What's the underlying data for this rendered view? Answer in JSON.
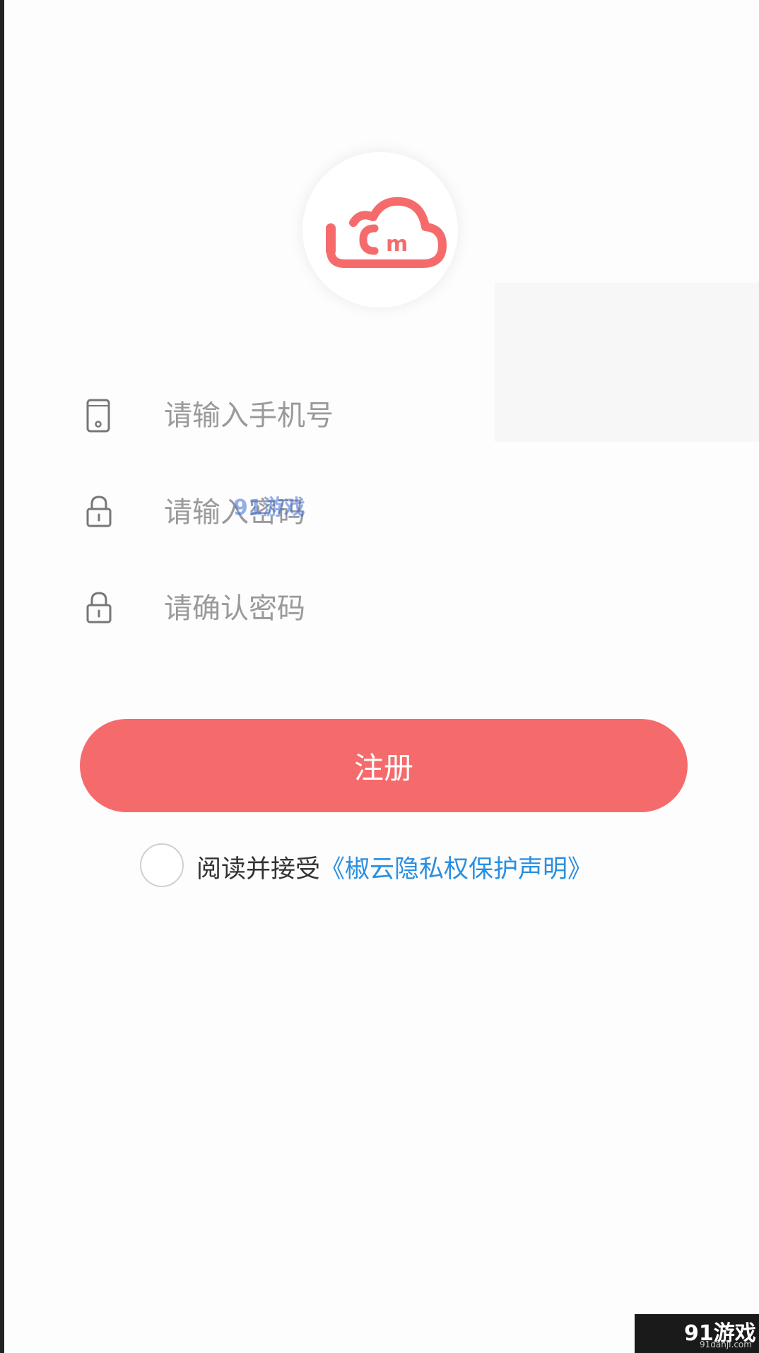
{
  "form": {
    "phone_placeholder": "请输入手机号",
    "password_placeholder": "请输入密码",
    "confirm_placeholder": "请确认密码"
  },
  "actions": {
    "register_label": "注册"
  },
  "agreement": {
    "prefix": "阅读并接受",
    "link_text": "《椒云隐私权保护声明》"
  },
  "watermark": {
    "center_text": "91游戏",
    "corner_brand": "91游戏",
    "corner_url": "91danji.com"
  },
  "colors": {
    "accent": "#f56b6c",
    "link": "#2b8fe0",
    "icon": "#777777"
  },
  "icons": {
    "logo": "ucm-cloud-logo",
    "phone": "phone-icon",
    "lock": "lock-icon"
  }
}
